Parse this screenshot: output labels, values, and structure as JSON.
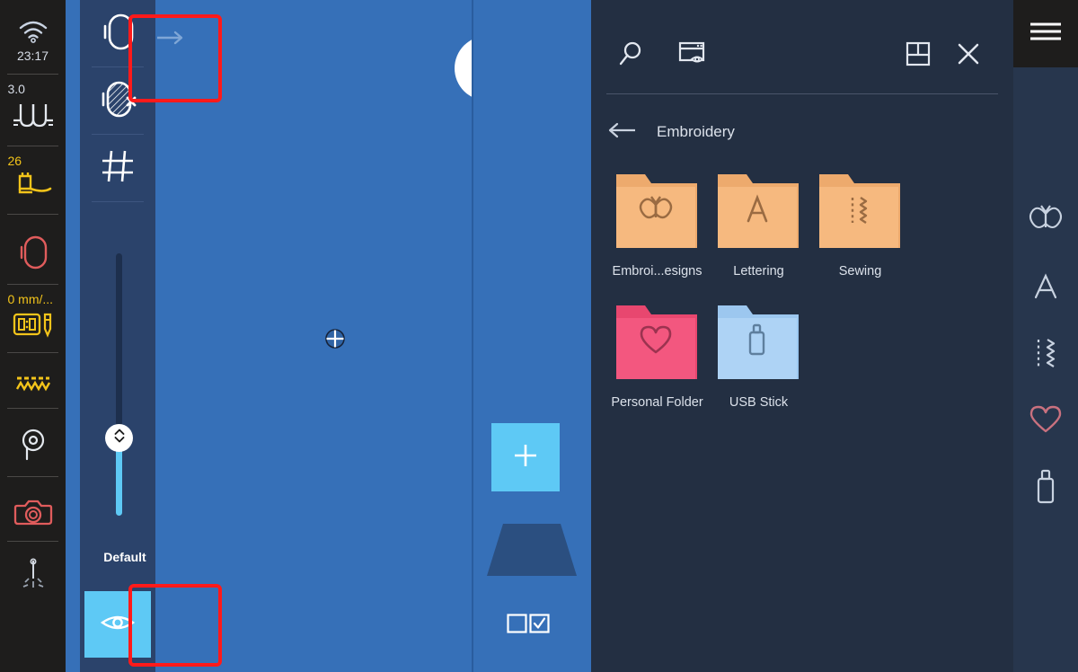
{
  "status_bar": {
    "items": [
      {
        "name": "wifi",
        "icon": "wifi-icon",
        "value": "23:17",
        "color": "#d6dce6",
        "value_color": "#c9d3e2"
      },
      {
        "name": "thread-tension",
        "icon": "thread-tension-icon",
        "value": "3.0",
        "color": "#d6dce6",
        "value_color": "#c9d3e2"
      },
      {
        "name": "presser-foot",
        "icon": "presser-foot-icon",
        "value": "26",
        "color": "#f3c41a",
        "value_color": "#f3c41a"
      },
      {
        "name": "hoop",
        "icon": "hoop-icon",
        "value": "",
        "color": "#e05c5c",
        "value_color": "#e05c5c"
      },
      {
        "name": "stitch-speed",
        "icon": "speed-pen-icon",
        "value": "0 mm/...",
        "color": "#f3c41a",
        "value_color": "#f3c41a"
      },
      {
        "name": "stitch-pattern",
        "icon": "zigzag-icon",
        "value": "",
        "color": "#f3c41a",
        "value_color": "#f3c41a"
      },
      {
        "name": "bobbin",
        "icon": "bobbin-icon",
        "value": "",
        "color": "#d6dce6",
        "value_color": "#d6dce6"
      },
      {
        "name": "camera",
        "icon": "camera-icon",
        "value": "",
        "color": "#e05c5c",
        "value_color": "#e05c5c"
      },
      {
        "name": "needle",
        "icon": "needle-icon",
        "value": "",
        "color": "#d6dce6",
        "value_color": "#d6dce6"
      }
    ]
  },
  "tool_column": {
    "expand_arrow": "arrow-right-icon",
    "buttons": [
      {
        "name": "hoop-select",
        "icon": "hoop-outline-icon",
        "selected": true,
        "highlighted": true
      },
      {
        "name": "hoop-disabled",
        "icon": "hoop-crossed-icon",
        "selected": false,
        "highlighted": false
      },
      {
        "name": "grid",
        "icon": "grid-hash-icon",
        "selected": false,
        "highlighted": false
      }
    ],
    "slider": {
      "name": "zoom-slider",
      "label": "Default",
      "fill_color": "#5ec9f5",
      "track_color": "#1d2f4d",
      "knob_icon": "updown-chevron-icon"
    },
    "eye_button": {
      "name": "preview-toggle",
      "icon": "eye-icon",
      "color": "#5ec9f5",
      "highlighted": true
    }
  },
  "canvas": {
    "background": "#3670b8",
    "edit_fab": {
      "name": "edit-button",
      "icon": "pencil-icon"
    },
    "cursor": {
      "name": "crosshair-cursor",
      "icon": "crosshair-icon"
    }
  },
  "middle_strip": {
    "add_button": {
      "name": "add-design-button",
      "icon": "plus-icon",
      "color": "#5ec9f5"
    },
    "hoop_shape": {
      "name": "hoop-preview-shape",
      "color": "#2b4f80"
    },
    "select_toggle": {
      "name": "select-all-toggle",
      "icon": "checkbox-pair-icon"
    }
  },
  "file_panel": {
    "toolbar": [
      {
        "name": "search-button",
        "icon": "search-icon"
      },
      {
        "name": "preview-window-button",
        "icon": "window-eye-icon"
      },
      {
        "name": "split-view-button",
        "icon": "split-window-icon"
      },
      {
        "name": "close-button",
        "icon": "close-x-icon"
      }
    ],
    "breadcrumb": {
      "back_icon": "arrow-left-icon",
      "title": "Embroidery"
    },
    "folders": [
      {
        "name": "folder-embroidery-designs",
        "label": "Embroi...esigns",
        "icon": "butterfly-icon",
        "color": "#f6b97f",
        "tab_color": "#edaa6d",
        "glyph_color": "#9a6b42"
      },
      {
        "name": "folder-lettering",
        "label": "Lettering",
        "icon": "letter-a-icon",
        "color": "#f6b97f",
        "tab_color": "#edaa6d",
        "glyph_color": "#9a6b42"
      },
      {
        "name": "folder-sewing",
        "label": "Sewing",
        "icon": "zigzag-stitch-icon",
        "color": "#f6b97f",
        "tab_color": "#edaa6d",
        "glyph_color": "#9a6b42"
      },
      {
        "name": "folder-personal",
        "label": "Personal Folder",
        "icon": "heart-icon",
        "color": "#f3577f",
        "tab_color": "#e8476f",
        "glyph_color": "#9c3350"
      },
      {
        "name": "folder-usb-stick",
        "label": "USB Stick",
        "icon": "usb-stick-icon",
        "color": "#aed3f5",
        "tab_color": "#9cc7ef",
        "glyph_color": "#5e7f9e"
      }
    ]
  },
  "right_rail": {
    "menu_button": {
      "name": "hamburger-menu-button",
      "icon": "hamburger-icon"
    },
    "items": [
      {
        "name": "rail-item-embroidery",
        "icon": "butterfly-icon",
        "color": "#c8d2e0"
      },
      {
        "name": "rail-item-lettering",
        "icon": "letter-a-icon",
        "color": "#c8d2e0"
      },
      {
        "name": "rail-item-sewing",
        "icon": "zigzag-stitch-icon",
        "color": "#c8d2e0"
      },
      {
        "name": "rail-item-personal",
        "icon": "heart-icon",
        "color": "#c9717f"
      },
      {
        "name": "rail-item-usb",
        "icon": "usb-stick-icon",
        "color": "#c8d2e0"
      }
    ]
  }
}
